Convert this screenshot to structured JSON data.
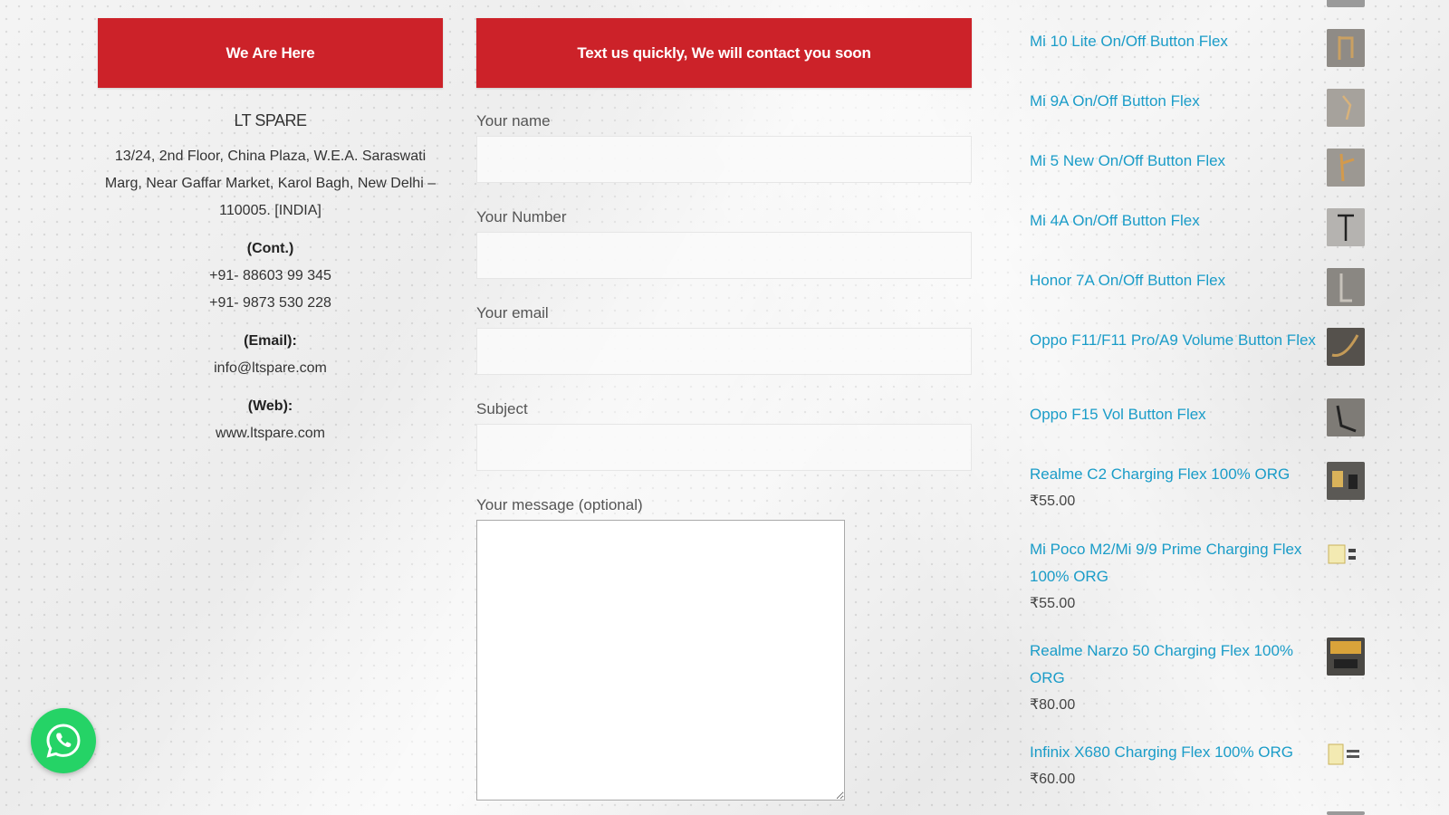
{
  "contact_header": "We Are Here",
  "form_header": "Text us quickly, We will contact you soon",
  "contact": {
    "company": "LT SPARE",
    "address": "13/24, 2nd Floor, China Plaza, W.E.A. Saraswati Marg, Near Gaffar Market, Karol Bagh, New Delhi – 110005. [INDIA]",
    "cont_label": "(Cont.)",
    "phone1": "+91- 88603 99 345",
    "phone2": "+91- 9873 530 228",
    "email_label": "(Email):",
    "email": "info@ltspare.com",
    "web_label": "(Web):",
    "web": "www.ltspare.com"
  },
  "form": {
    "name_label": "Your name",
    "number_label": "Your Number",
    "email_label": "Your email",
    "subject_label": "Subject",
    "message_label": "Your message (optional)"
  },
  "products": [
    {
      "name": "Mi 10 Lite On/Off Button Flex",
      "price": ""
    },
    {
      "name": "Mi 9A On/Off Button Flex",
      "price": ""
    },
    {
      "name": "Mi 5 New On/Off Button Flex",
      "price": ""
    },
    {
      "name": "Mi 4A On/Off Button Flex",
      "price": ""
    },
    {
      "name": "Honor 7A On/Off Button Flex",
      "price": ""
    },
    {
      "name": "Oppo F11/F11 Pro/A9 Volume Button Flex",
      "price": ""
    },
    {
      "name": "Oppo F15 Vol Button Flex",
      "price": ""
    },
    {
      "name": "Realme C2 Charging Flex 100% ORG",
      "price": "₹55.00"
    },
    {
      "name": "Mi Poco M2/Mi 9/9 Prime Charging Flex 100% ORG",
      "price": "₹55.00"
    },
    {
      "name": "Realme Narzo 50 Charging Flex 100% ORG",
      "price": "₹80.00"
    },
    {
      "name": "Infinix X680 Charging Flex 100% ORG",
      "price": "₹60.00"
    }
  ],
  "icons": {
    "whatsapp": "whatsapp-icon",
    "product_thumb": "product-thumbnail"
  },
  "colors": {
    "header_red": "#cc2229",
    "link_blue": "#1a9cc8",
    "whatsapp_green": "#25d366"
  }
}
